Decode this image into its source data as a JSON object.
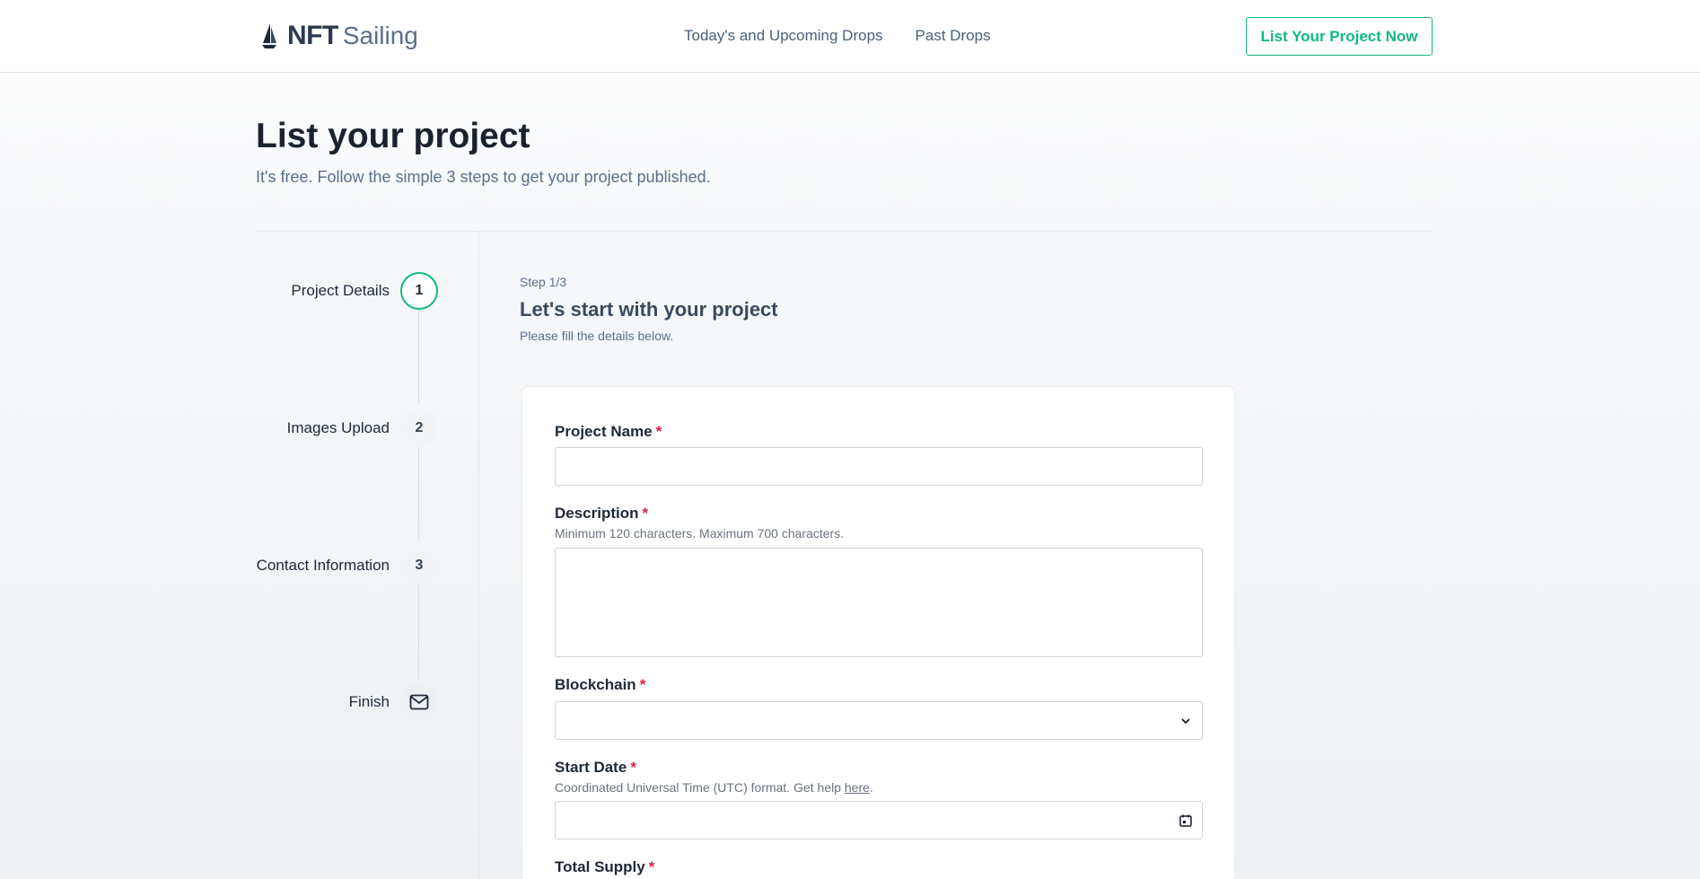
{
  "brand": {
    "name_bold": "NFT",
    "name_light": "Sailing"
  },
  "nav": {
    "items": [
      {
        "label": "Today's and Upcoming Drops"
      },
      {
        "label": "Past Drops"
      }
    ],
    "cta_label": "List Your Project Now"
  },
  "page": {
    "title": "List your project",
    "subtitle": "It's free. Follow the simple 3 steps to get your project published."
  },
  "steps": [
    {
      "label": "Project Details",
      "number": "1",
      "state": "active"
    },
    {
      "label": "Images Upload",
      "number": "2",
      "state": "pending"
    },
    {
      "label": "Contact Information",
      "number": "3",
      "state": "pending"
    },
    {
      "label": "Finish",
      "icon": "envelope-icon",
      "state": "pending"
    }
  ],
  "form": {
    "step_counter": "Step 1/3",
    "heading": "Let's start with your project",
    "subheading": "Please fill the details below.",
    "required_mark": "*",
    "fields": {
      "project_name": {
        "label": "Project Name",
        "value": ""
      },
      "description": {
        "label": "Description",
        "help": "Minimum 120 characters. Maximum 700 characters.",
        "value": ""
      },
      "blockchain": {
        "label": "Blockchain",
        "selected": ""
      },
      "start_date": {
        "label": "Start Date",
        "help_prefix": "Coordinated Universal Time (UTC) format. Get help ",
        "help_link": "here",
        "help_suffix": ".",
        "value": ""
      },
      "total_supply": {
        "label": "Total Supply"
      }
    }
  },
  "colors": {
    "accent": "#10b981",
    "required": "#e11d48",
    "text_muted": "#5a6f8c"
  }
}
